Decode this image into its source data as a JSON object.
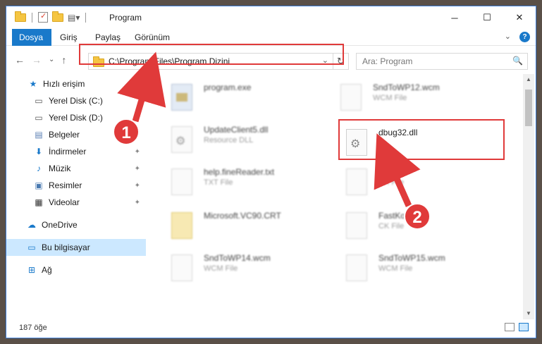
{
  "window": {
    "title": "Program",
    "controls": {
      "minimize": "─",
      "maximize": "☐",
      "close": "✕"
    }
  },
  "ribbon": {
    "tabs": [
      "Dosya",
      "Giriş",
      "Paylaş",
      "Görünüm"
    ],
    "expand": "⌄",
    "help": "?"
  },
  "nav": {
    "back": "←",
    "forward": "→",
    "recent": "⌄",
    "up": "↑",
    "address": "C:\\Program Files\\Program Dizini",
    "address_chevron": "⌄",
    "refresh": "↻",
    "search_placeholder": "Ara: Program",
    "search_icon": "🔍"
  },
  "sidebar": {
    "items": [
      {
        "label": "Hızlı erişim",
        "icon": "star-icon"
      },
      {
        "label": "Yerel Disk (C:)",
        "icon": "drive-icon"
      },
      {
        "label": "Yerel Disk (D:)",
        "icon": "drive-icon"
      },
      {
        "label": "Belgeler",
        "icon": "documents-icon"
      },
      {
        "label": "İndirmeler",
        "icon": "downloads-icon"
      },
      {
        "label": "Müzik",
        "icon": "music-icon"
      },
      {
        "label": "Resimler",
        "icon": "pictures-icon"
      },
      {
        "label": "Videolar",
        "icon": "videos-icon"
      },
      {
        "label": "OneDrive",
        "icon": "onedrive-icon"
      },
      {
        "label": "Bu bilgisayar",
        "icon": "computer-icon"
      },
      {
        "label": "Ağ",
        "icon": "network-icon"
      }
    ],
    "pin_glyph": "📌"
  },
  "files": [
    {
      "name": "program.exe",
      "type": ""
    },
    {
      "name": "SndToWP12.wcm",
      "type": "WCM File"
    },
    {
      "name": "UpdateClient5.dll",
      "type": "Resource DLL"
    },
    {
      "name": "dbug32.dll",
      "type": ""
    },
    {
      "name": "help.fineReader.txt",
      "type": "TXT File"
    },
    {
      "name": "gl...",
      "type": "CK File"
    },
    {
      "name": "Microsoft.VC90.CRT",
      "type": ""
    },
    {
      "name": "FastKo...",
      "type": "CK File"
    },
    {
      "name": "SndToWP14.wcm",
      "type": "WCM File"
    },
    {
      "name": "SndToWP15.wcm",
      "type": "WCM File"
    }
  ],
  "status": {
    "count": "187 öğe"
  },
  "annotations": {
    "step1": "1",
    "step2": "2",
    "color": "#e03a3a"
  }
}
